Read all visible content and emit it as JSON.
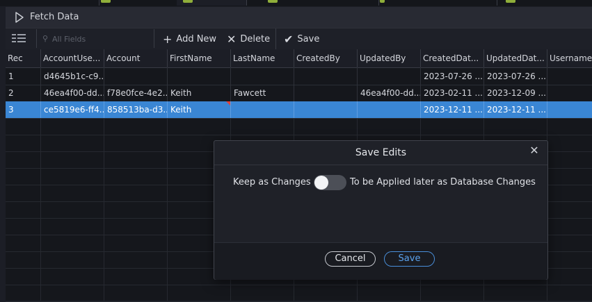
{
  "fetch": {
    "label": "Fetch Data"
  },
  "toolbar": {
    "search_placeholder": "All Fields",
    "add_label": "Add New",
    "delete_label": "Delete",
    "save_label": "Save"
  },
  "grid": {
    "columns": [
      "Rec",
      "AccountUse...",
      "Account",
      "FirstName",
      "LastName",
      "CreatedBy",
      "UpdatedBy",
      "CreatedDat...",
      "UpdatedDat...",
      "Username"
    ],
    "rows": [
      [
        "1",
        "d4645b1c-c9...",
        "",
        "",
        "",
        "",
        "",
        "2023-07-26 ...",
        "2023-07-26 ...",
        ""
      ],
      [
        "2",
        "46ea4f00-dd...",
        "f78e0fce-4e2...",
        "Keith",
        "Fawcett",
        "",
        "46ea4f00-dd...",
        "2023-02-11 ...",
        "2023-12-09 ...",
        ""
      ],
      [
        "3",
        "ce5819e6-ff4...",
        "858513ba-d3...",
        "Keith",
        "",
        "",
        "",
        "2023-12-11 ...",
        "2023-12-11 ...",
        ""
      ]
    ],
    "selected_row": 3
  },
  "dialog": {
    "title": "Save Edits",
    "left_label": "Keep as Changes",
    "right_label": "To be Applied later as Database Changes",
    "cancel_label": "Cancel",
    "save_label": "Save",
    "toggle_on": false
  },
  "colors": {
    "selection": "#3a86d4",
    "accent": "#4a90dc",
    "tab_icon": "#8fae3a",
    "modified_marker": "#e0413c"
  }
}
